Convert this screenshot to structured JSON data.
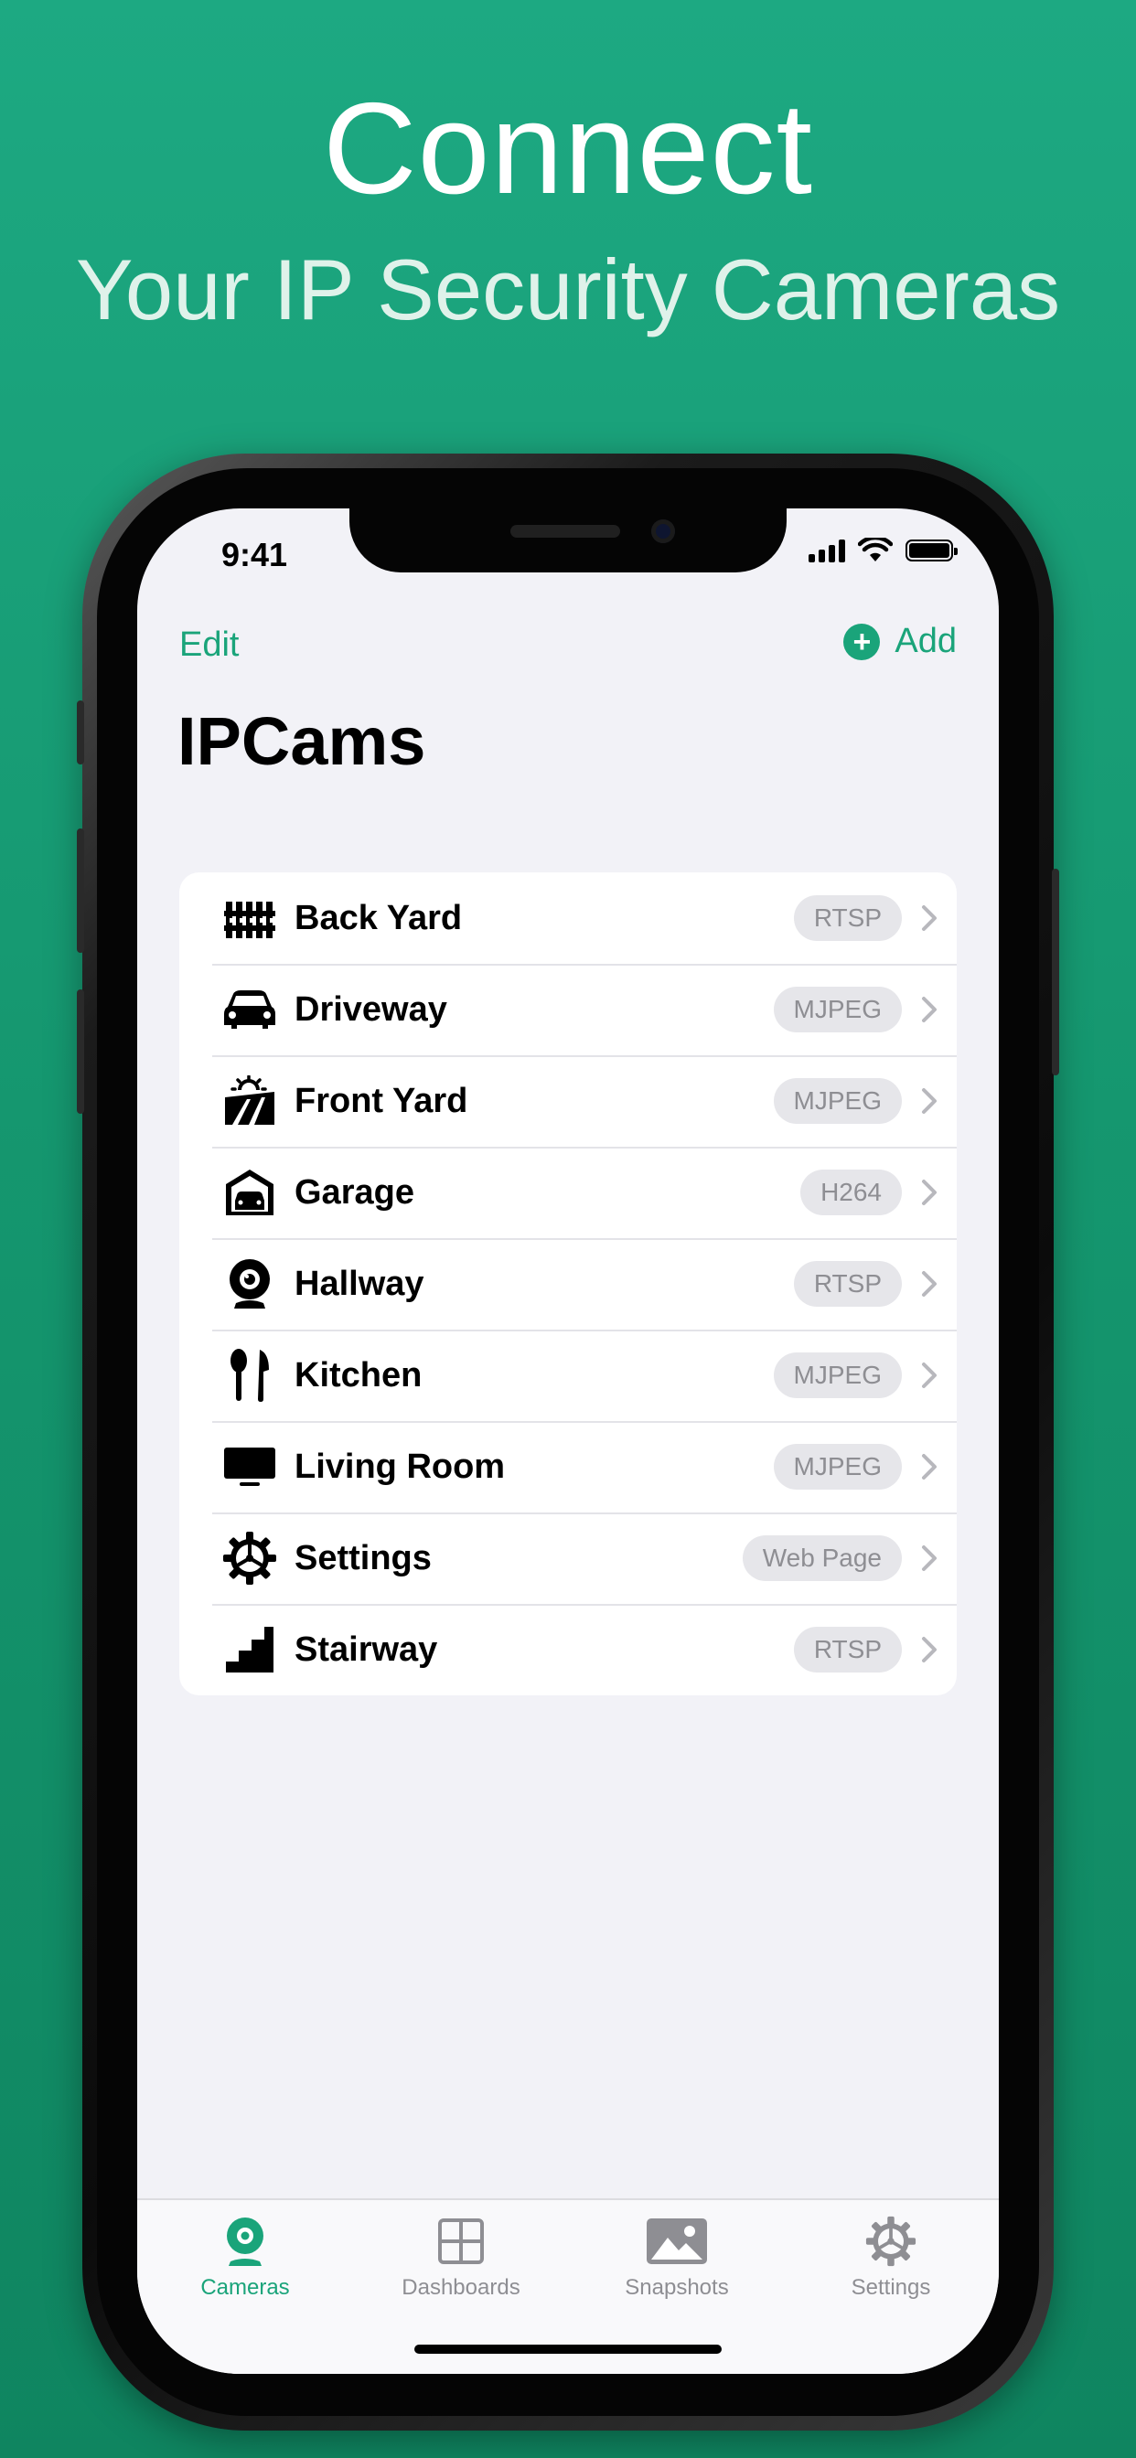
{
  "promo": {
    "headline": "Connect",
    "subheadline": "Your IP Security Cameras"
  },
  "status_bar": {
    "time": "9:41"
  },
  "nav": {
    "edit_label": "Edit",
    "add_label": "Add",
    "title": "IPCams"
  },
  "cameras": [
    {
      "name": "Back Yard",
      "protocol": "RTSP",
      "icon": "fence-icon"
    },
    {
      "name": "Driveway",
      "protocol": "MJPEG",
      "icon": "car-icon"
    },
    {
      "name": "Front Yard",
      "protocol": "MJPEG",
      "icon": "field-sun-icon"
    },
    {
      "name": "Garage",
      "protocol": "H264",
      "icon": "garage-car-icon"
    },
    {
      "name": "Hallway",
      "protocol": "RTSP",
      "icon": "webcam-icon"
    },
    {
      "name": "Kitchen",
      "protocol": "MJPEG",
      "icon": "fork-spoon-icon"
    },
    {
      "name": "Living Room",
      "protocol": "MJPEG",
      "icon": "tv-icon"
    },
    {
      "name": "Settings",
      "protocol": "Web Page",
      "icon": "gear-icon"
    },
    {
      "name": "Stairway",
      "protocol": "RTSP",
      "icon": "stairs-icon"
    }
  ],
  "tabs": [
    {
      "label": "Cameras",
      "icon": "camera-tab-icon",
      "active": true
    },
    {
      "label": "Dashboards",
      "icon": "grid-icon",
      "active": false
    },
    {
      "label": "Snapshots",
      "icon": "photo-icon",
      "active": false
    },
    {
      "label": "Settings",
      "icon": "gear-tab-icon",
      "active": false
    }
  ],
  "colors": {
    "accent": "#1aa47a",
    "background_top": "#1da982",
    "background_bottom": "#0f8560",
    "badge_bg": "#e6e6ea",
    "badge_text": "#8e8e93"
  }
}
